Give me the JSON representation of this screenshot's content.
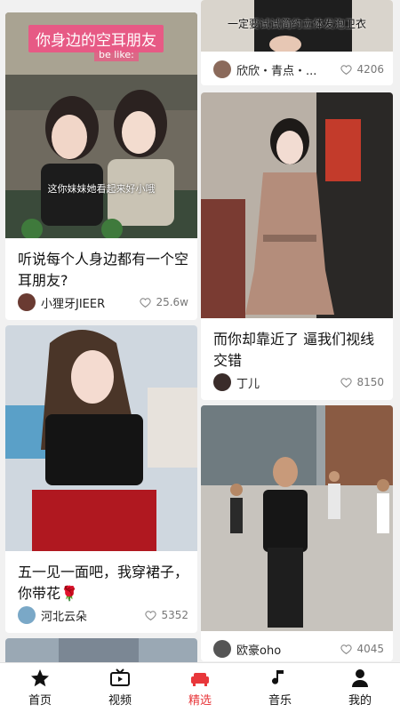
{
  "feed": {
    "cards": [
      {
        "overlay_title": "你身边的空耳朋友",
        "overlay_sub": "be like:",
        "subtitle": "这你妹妹她看起来好小哦",
        "caption": "听说每个人身边都有一个空耳朋友?",
        "author": "小狸牙JIEER",
        "likes": "25.6w"
      },
      {
        "overlay_text": "一定要试试简约立体发泡卫衣",
        "author": "欣欣・青点・...",
        "likes": "4206"
      },
      {
        "caption": "而你却靠近了 逼我们视线交错",
        "author": "丁儿",
        "likes": "8150"
      },
      {
        "caption": "五一见一面吧，我穿裙子，你带花🌹",
        "author": "河北云朵",
        "likes": "5352"
      },
      {
        "author": "欧豪oho",
        "likes": "4045"
      }
    ]
  },
  "tabbar": {
    "tabs": [
      {
        "label": "首页",
        "icon": "star-home-icon"
      },
      {
        "label": "视频",
        "icon": "tv-icon"
      },
      {
        "label": "精选",
        "icon": "sofa-icon",
        "active": true
      },
      {
        "label": "音乐",
        "icon": "music-note-icon"
      },
      {
        "label": "我的",
        "icon": "person-icon"
      }
    ],
    "active_color": "#e8373b"
  }
}
